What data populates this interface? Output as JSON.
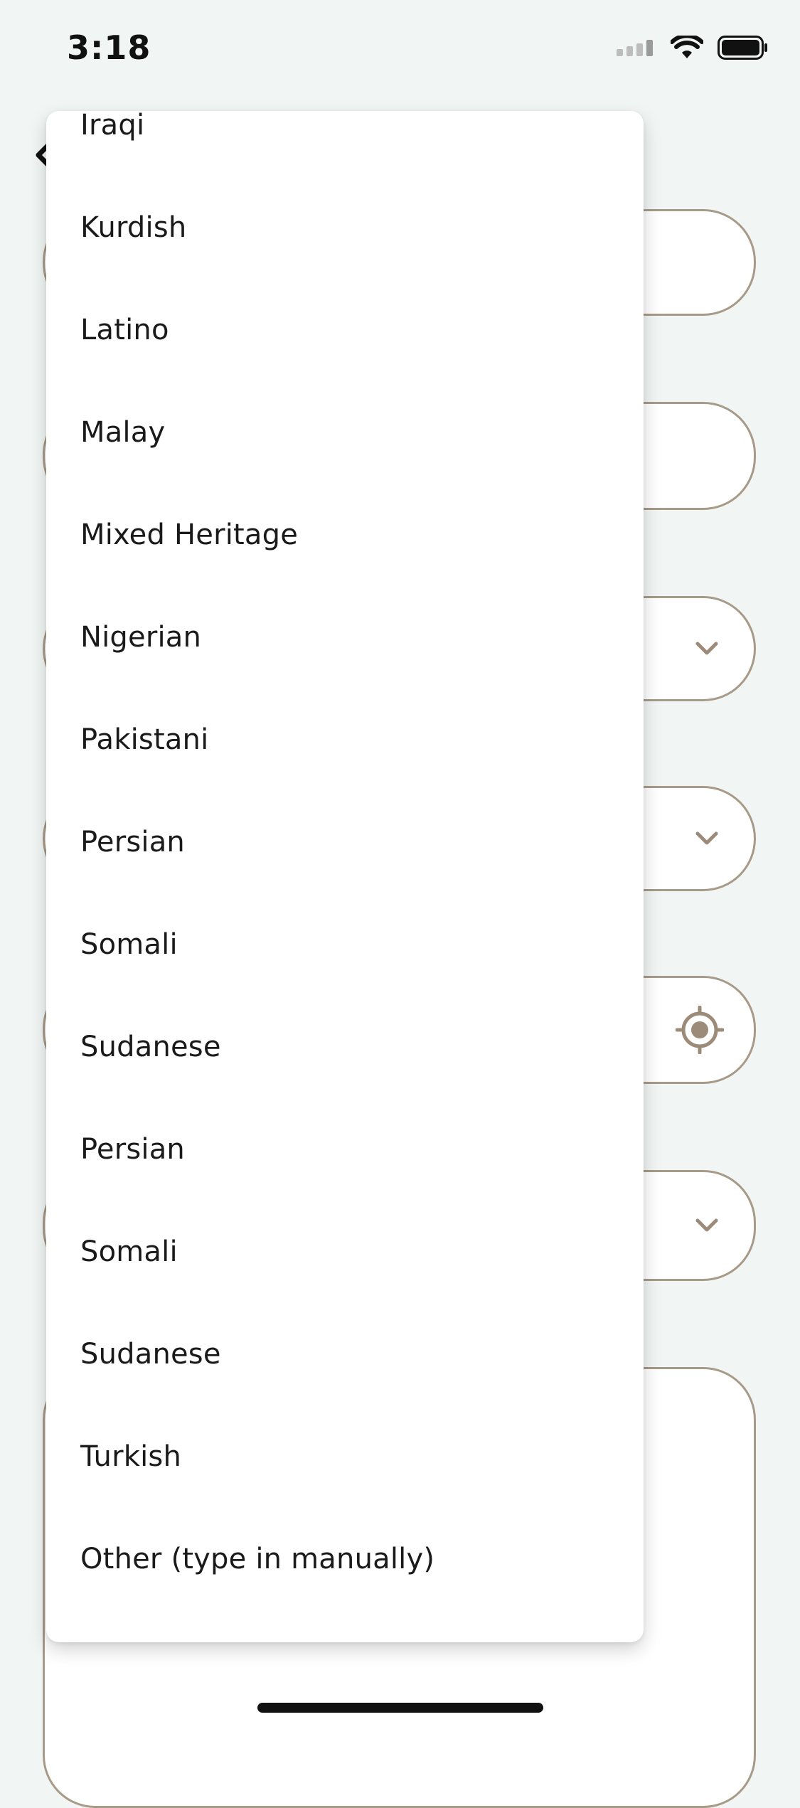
{
  "status_bar": {
    "time": "3:18"
  },
  "icons": {
    "back": "chevron-left-icon",
    "signal": "cellular-signal-icon",
    "wifi": "wifi-icon",
    "battery": "battery-icon",
    "field_dropdown": "chevron-down-icon",
    "location": "location-target-icon"
  },
  "colors": {
    "background": "#f1f6f4",
    "field_border": "#a89a88",
    "accent": "#9c8b78",
    "text": "#1a1a1a"
  },
  "dropdown": {
    "items": [
      "Iraqi",
      "Kurdish",
      "Latino",
      "Malay",
      "Mixed Heritage",
      "Nigerian",
      "Pakistani",
      "Persian",
      "Somali",
      "Sudanese",
      "Persian",
      "Somali",
      "Sudanese",
      "Turkish",
      "Other (type in manually)"
    ]
  }
}
